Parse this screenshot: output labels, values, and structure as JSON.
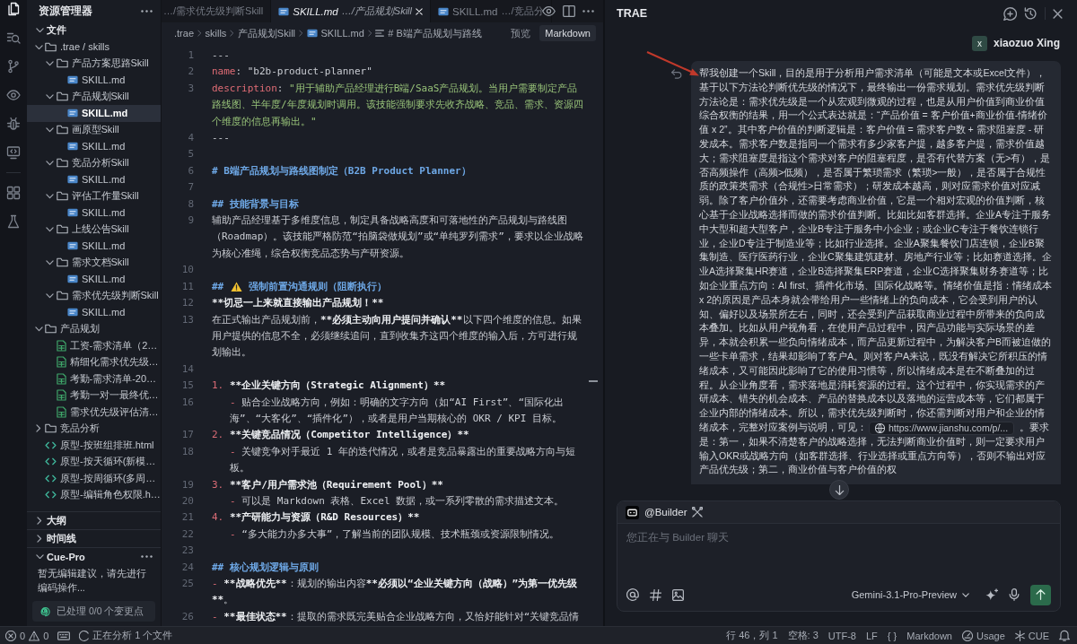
{
  "activity_bar": [
    {
      "items": [
        {
          "kind": "files",
          "selected": true
        },
        {
          "kind": "search",
          "selected": false
        },
        {
          "kind": "source_control",
          "selected": false
        },
        {
          "kind": "preview",
          "selected": false
        },
        {
          "kind": "debug",
          "selected": false
        },
        {
          "kind": "remote",
          "selected": false
        }
      ]
    },
    {
      "items": [
        {
          "kind": "extensions",
          "selected": false
        },
        {
          "kind": "testing",
          "selected": false
        }
      ]
    }
  ],
  "explorer": {
    "title": "资源管理器",
    "sections": [
      {
        "kind": "files",
        "title": "文件",
        "expanded": true,
        "tree": [
          {
            "label": ".trae / skills",
            "kind": "folder",
            "expanded": true,
            "selected": false,
            "children": [
              {
                "label": "产品方案思路Skill",
                "kind": "folder",
                "expanded": true,
                "selected": false,
                "children": [
                  {
                    "label": "SKILL.md",
                    "kind": "markdown",
                    "selected": false
                  }
                ]
              },
              {
                "label": "产品规划Skill",
                "kind": "folder",
                "expanded": true,
                "selected": false,
                "children": [
                  {
                    "label": "SKILL.md",
                    "kind": "markdown",
                    "selected": true
                  }
                ]
              },
              {
                "label": "画原型Skill",
                "kind": "folder",
                "expanded": true,
                "selected": false,
                "children": [
                  {
                    "label": "SKILL.md",
                    "kind": "markdown",
                    "selected": false
                  }
                ]
              },
              {
                "label": "竞品分析Skill",
                "kind": "folder",
                "expanded": true,
                "selected": false,
                "children": [
                  {
                    "label": "SKILL.md",
                    "kind": "markdown",
                    "selected": false
                  }
                ]
              },
              {
                "label": "评估工作量Skill",
                "kind": "folder",
                "expanded": true,
                "selected": false,
                "children": [
                  {
                    "label": "SKILL.md",
                    "kind": "markdown",
                    "selected": false
                  }
                ]
              },
              {
                "label": "上线公告Skill",
                "kind": "folder",
                "expanded": true,
                "selected": false,
                "children": [
                  {
                    "label": "SKILL.md",
                    "kind": "markdown",
                    "selected": false
                  }
                ]
              },
              {
                "label": "需求文档Skill",
                "kind": "folder",
                "expanded": true,
                "selected": false,
                "children": [
                  {
                    "label": "SKILL.md",
                    "kind": "markdown",
                    "selected": false
                  }
                ]
              },
              {
                "label": "需求优先级判断Skill",
                "kind": "folder",
                "expanded": true,
                "selected": false,
                "children": [
                  {
                    "label": "SKILL.md",
                    "kind": "markdown",
                    "selected": false
                  }
                ]
              }
            ]
          },
          {
            "label": "产品规划",
            "kind": "folder",
            "expanded": true,
            "selected": false,
            "children": [
              {
                "label": "工资-需求清单（2…",
                "kind": "spreadsheet",
                "selected": false
              },
              {
                "label": "精细化需求优先级…",
                "kind": "spreadsheet",
                "selected": false
              },
              {
                "label": "考勤-需求清单-20…",
                "kind": "spreadsheet",
                "selected": false
              },
              {
                "label": "考勤一对一最终优…",
                "kind": "spreadsheet",
                "selected": false
              },
              {
                "label": "需求优先级评估清…",
                "kind": "spreadsheet",
                "selected": false
              }
            ]
          },
          {
            "label": "竞品分析",
            "kind": "folder",
            "expanded": false,
            "selected": false
          },
          {
            "label": "原型-按班组排班.html",
            "kind": "html",
            "selected": false
          },
          {
            "label": "原型-按天循环(新模…",
            "kind": "html",
            "selected": false
          },
          {
            "label": "原型-按周循环(多周…",
            "kind": "html",
            "selected": false
          },
          {
            "label": "原型-编辑角色权限.h…",
            "kind": "html",
            "selected": false
          }
        ]
      },
      {
        "kind": "outline",
        "title": "大纲",
        "expanded": false
      },
      {
        "kind": "timeline",
        "title": "时间线",
        "expanded": false
      },
      {
        "kind": "cue",
        "title": "Cue-Pro",
        "expanded": true,
        "message": "暂无编辑建议，请先进行编码操作...",
        "status": "已处理 0/0 个变更点"
      }
    ]
  },
  "editor": {
    "tabs": [
      {
        "path": "…/需求优先级判断Skill",
        "selected": false
      },
      {
        "file": "SKILL.md",
        "path": "…/产品规划Skill",
        "selected": true
      },
      {
        "file": "SKILL.md",
        "path": "…/竞品分",
        "selected": false
      }
    ],
    "breadcrumbs": [
      {
        "kind": "folder",
        "label": ".trae"
      },
      {
        "kind": "folder",
        "label": "skills"
      },
      {
        "kind": "folder",
        "label": "产品规划Skill"
      },
      {
        "kind": "file",
        "label": "SKILL.md"
      },
      {
        "kind": "symbol",
        "label": "# B端产品规划与路线"
      }
    ],
    "view_modes": [
      {
        "label": "预览",
        "selected": false
      },
      {
        "label": "Markdown",
        "selected": true
      }
    ],
    "lines": [
      {
        "number": "1",
        "segments": [
          {
            "kind": "plain",
            "text": "---"
          }
        ]
      },
      {
        "number": "2",
        "segments": [
          {
            "kind": "key",
            "text": "name"
          },
          {
            "kind": "plain",
            "text": ": \"b2b-product-planner\""
          }
        ]
      },
      {
        "number": "3",
        "segments": [
          {
            "kind": "key",
            "text": "description"
          },
          {
            "kind": "plain",
            "text": ": "
          },
          {
            "kind": "string",
            "text": "\"用于辅助产品经理进行B端/SaaS产品规划。当用户需要制定产品路线图、半年度/年度规划时调用。该技能强制要求先收齐战略、竞品、需求、资源四个维度的信息再输出。\""
          }
        ]
      },
      {
        "number": "4",
        "segments": [
          {
            "kind": "plain",
            "text": "---"
          }
        ]
      },
      {
        "number": "5"
      },
      {
        "number": "6",
        "segments": [
          {
            "kind": "heading",
            "text": "# B端产品规划与路线图制定（B2B Product Planner）"
          }
        ]
      },
      {
        "number": "7"
      },
      {
        "number": "8",
        "segments": [
          {
            "kind": "heading",
            "text": "## 技能背景与目标"
          }
        ]
      },
      {
        "number": "9",
        "segments": [
          {
            "kind": "plain",
            "text": "辅助产品经理基于多维度信息，制定具备战略高度和可落地性的产品规划与路线图（Roadmap）。该技能严格防范“拍脑袋做规划”或“单纯罗列需求”，要求以企业战略为核心准绳，综合权衡竞品态势与产研资源。"
          }
        ]
      },
      {
        "number": "10"
      },
      {
        "number": "11",
        "segments": [
          {
            "kind": "heading",
            "text": "## "
          },
          {
            "kind": "warning_icon"
          },
          {
            "kind": "heading",
            "text": " 强制前置沟通规则（阻断执行）"
          }
        ]
      },
      {
        "number": "12",
        "segments": [
          {
            "kind": "bold_marker",
            "text": "**"
          },
          {
            "kind": "bold",
            "text": "切忌一上来就直接输出产品规划！"
          },
          {
            "kind": "bold_marker",
            "text": "**"
          }
        ]
      },
      {
        "number": "13",
        "segments": [
          {
            "kind": "plain",
            "text": "在正式输出产品规划前，"
          },
          {
            "kind": "bold_marker",
            "text": "**"
          },
          {
            "kind": "bold",
            "text": "必须主动向用户提问并确认"
          },
          {
            "kind": "bold_marker",
            "text": "**"
          },
          {
            "kind": "plain",
            "text": "以下四个维度的信息。如果用户提供的信息不全，必须继续追问，直到收集齐这四个维度的输入后，方可进行规划输出。"
          }
        ]
      },
      {
        "number": "14"
      },
      {
        "number": "15",
        "segments": [
          {
            "kind": "list_marker",
            "text": "1. "
          },
          {
            "kind": "bold_marker",
            "text": "**"
          },
          {
            "kind": "bold",
            "text": "企业关键方向（Strategic Alignment）"
          },
          {
            "kind": "bold_marker",
            "text": "**"
          }
        ],
        "children": [
          {
            "number": "16",
            "segments": [
              {
                "kind": "list_marker",
                "text": "- "
              },
              {
                "kind": "plain",
                "text": "贴合企业战略方向，例如：明确的文字方向（如“AI First”、“国际化出海”、“大客化”、“插件化”），或者是用户当期核心的 OKR / KPI 目标。"
              }
            ]
          }
        ]
      },
      {
        "number": "17",
        "segments": [
          {
            "kind": "list_marker",
            "text": "2. "
          },
          {
            "kind": "bold_marker",
            "text": "**"
          },
          {
            "kind": "bold",
            "text": "关键竞品情况（Competitor Intelligence）"
          },
          {
            "kind": "bold_marker",
            "text": "**"
          }
        ],
        "children": [
          {
            "number": "18",
            "segments": [
              {
                "kind": "list_marker",
                "text": "- "
              },
              {
                "kind": "plain",
                "text": "关键竞争对手最近 1 年的迭代情况，或者是竞品暴露出的重要战略方向与短板。"
              }
            ]
          }
        ]
      },
      {
        "number": "19",
        "segments": [
          {
            "kind": "list_marker",
            "text": "3. "
          },
          {
            "kind": "bold_marker",
            "text": "**"
          },
          {
            "kind": "bold",
            "text": "客户/用户需求池（Requirement Pool）"
          },
          {
            "kind": "bold_marker",
            "text": "**"
          }
        ],
        "children": [
          {
            "number": "20",
            "segments": [
              {
                "kind": "list_marker",
                "text": "- "
              },
              {
                "kind": "plain",
                "text": "可以是 Markdown 表格、Excel 数据，或一系列零散的需求描述文本。"
              }
            ]
          }
        ]
      },
      {
        "number": "21",
        "segments": [
          {
            "kind": "list_marker",
            "text": "4. "
          },
          {
            "kind": "bold_marker",
            "text": "**"
          },
          {
            "kind": "bold",
            "text": "产研能力与资源（R&D Resources）"
          },
          {
            "kind": "bold_marker",
            "text": "**"
          }
        ],
        "children": [
          {
            "number": "22",
            "segments": [
              {
                "kind": "list_marker",
                "text": "- "
              },
              {
                "kind": "plain",
                "text": "“多大能力办多大事”，了解当前的团队规模、技术瓶颈或资源限制情况。"
              }
            ]
          }
        ]
      },
      {
        "number": "23"
      },
      {
        "number": "24",
        "segments": [
          {
            "kind": "heading",
            "text": "## 核心规划逻辑与原则"
          }
        ]
      },
      {
        "number": "25",
        "segments": [
          {
            "kind": "list_marker",
            "text": "- "
          },
          {
            "kind": "bold_marker",
            "text": "**"
          },
          {
            "kind": "bold",
            "text": "战略优先"
          },
          {
            "kind": "bold_marker",
            "text": "**"
          },
          {
            "kind": "plain",
            "text": "：规划的输出内容"
          },
          {
            "kind": "bold_marker",
            "text": "**"
          },
          {
            "kind": "bold",
            "text": "必须以“企业关键方向（战略）”为第一优先级"
          },
          {
            "kind": "bold_marker",
            "text": "**"
          },
          {
            "kind": "plain",
            "text": "。"
          }
        ]
      },
      {
        "number": "26",
        "segments": [
          {
            "kind": "list_marker",
            "text": "- "
          },
          {
            "kind": "bold_marker",
            "text": "**"
          },
          {
            "kind": "bold",
            "text": "最佳状态"
          },
          {
            "kind": "bold_marker",
            "text": "**"
          },
          {
            "kind": "plain",
            "text": "：提取的需求既完美贴合企业战略方向，又恰好能针对“关键竞品情"
          }
        ]
      }
    ]
  },
  "chat": {
    "title": "TRAE",
    "user": {
      "initial": "x",
      "name": "xiaozuo Xing"
    },
    "message": {
      "text": "帮我创建一个Skill，目的是用于分析用户需求清单（可能是文本或Excel文件），基于以下方法论判断优先级的情况下，最终输出一份需求规划。需求优先级判断方法论是：需求优先级是一个从宏观到微观的过程，也是从用户价值到商业价值综合权衡的结果，用一个公式表达就是：“产品价值 = 客户价值+商业价值-情绪价值 x 2”。其中客户价值的判断逻辑是：客户价值 = 需求客户数 + 需求阻塞度 - 研发成本。需求客户数是指同一个需求有多少家客户提，越多客户提，需求价值越大；需求阻塞度是指这个需求对客户的阻塞程度，是否有代替方案（无>有），是否高频操作（高频>低频），是否属于繁琐需求（繁琐>一般），是否属于合规性质的政策类需求（合规性>日常需求）；研发成本越高，则对应需求价值对应减弱。除了客户价值外，还需要考虑商业价值，它是一个相对宏观的价值判断，核心基于企业战略选择而做的需求价值判断。比如比如客群选择。企业A专注于服务中大型和超大型客户，企业B专注于服务中小企业；或企业C专注于餐饮连锁行业，企业D专注于制造业等；比如行业选择。企业A聚集餐饮门店连锁，企业B聚集制造、医疗医药行业，企业C聚集建筑建材、房地产行业等；比如赛道选择。企业A选择聚集HR赛道，企业B选择聚集ERP赛道，企业C选择聚集财务赛道等；比如企业重点方向：AI first、插件化市场、国际化战略等。情绪价值是指：情绪成本x 2的原因是产品本身就会带给用户一些情绪上的负向成本，它会受到用户的认知、偏好以及场景所左右，同时，还会受到产品获取商业过程中所带来的负向成本叠加。比如从用户视角看，在使用产品过程中，因产品功能与实际场景的差异，本就会积累一些负向情绪成本，而产品更新过程中，为解决客户B而被迫做的一些卡单需求，结果却影响了客户A。则对客户A来说，既没有解决它所积压的情绪成本，又可能因此影响了它的使用习惯等，所以情绪成本是在不断叠加的过程。从企业角度看，需求落地是消耗资源的过程。这个过程中，你实现需求的产研成本、错失的机会成本、产品的替换成本以及落地的运营成本等，它们都属于企业内部的情绪成本。所以，需求优先级判断时，你还需判断对用户和企业的情绪成本，完整对应案例与说明，可见：",
      "link": "https://www.jianshu.com/p/...",
      "text_after": "。要求是：第一，如果不清楚客户的战略选择，无法判断商业价值时，则一定要求用户输入OKR或战略方向（如客群选择、行业选择或重点方向等），否则不输出对应产品优先级；第二，商业价值与客户价值的权"
    },
    "composer": {
      "agent": "@Builder",
      "placeholder": "您正在与 Builder 聊天",
      "model": "Gemini-3.1-Pro-Preview"
    }
  },
  "status_bar": {
    "errors": "0",
    "warnings": "0",
    "task": "正在分析 1 个文件",
    "items": [
      {
        "kind": "text",
        "label": "行 46，列 1"
      },
      {
        "kind": "text",
        "label": "空格: 3"
      },
      {
        "kind": "text",
        "label": "UTF-8"
      },
      {
        "kind": "text",
        "label": "LF"
      },
      {
        "kind": "text",
        "label": "{ }"
      },
      {
        "kind": "text",
        "label": "Markdown"
      },
      {
        "kind": "usage",
        "label": "Usage"
      },
      {
        "kind": "cue",
        "label": "CUE"
      }
    ]
  }
}
